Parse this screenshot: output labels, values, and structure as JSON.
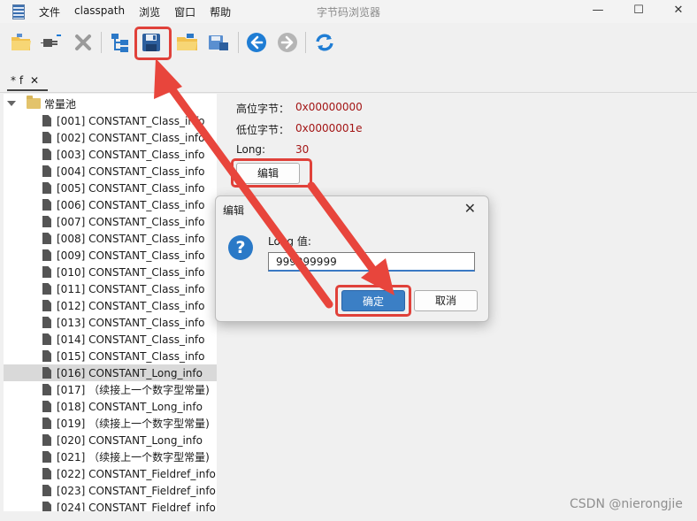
{
  "window": {
    "title": "字节码浏览器",
    "menu": [
      "文件",
      "classpath",
      "浏览",
      "窗口",
      "帮助"
    ],
    "controls": {
      "minimize": "—",
      "maximize": "☐",
      "close": "✕"
    }
  },
  "toolbar": {
    "icons": [
      "open-folder-icon",
      "plug-icon",
      "close-x-icon",
      "tree-icon",
      "save-icon",
      "open-dir-icon",
      "save-as-icon",
      "back-arrow-icon",
      "forward-arrow-icon",
      "refresh-icon"
    ],
    "accent": "#2a79c7"
  },
  "tabs": [
    {
      "label": "* f",
      "close": "✕"
    }
  ],
  "tree": {
    "root": "常量池",
    "items": [
      "[001] CONSTANT_Class_info",
      "[002] CONSTANT_Class_info",
      "[003] CONSTANT_Class_info",
      "[004] CONSTANT_Class_info",
      "[005] CONSTANT_Class_info",
      "[006] CONSTANT_Class_info",
      "[007] CONSTANT_Class_info",
      "[008] CONSTANT_Class_info",
      "[009] CONSTANT_Class_info",
      "[010] CONSTANT_Class_info",
      "[011] CONSTANT_Class_info",
      "[012] CONSTANT_Class_info",
      "[013] CONSTANT_Class_info",
      "[014] CONSTANT_Class_info",
      "[015] CONSTANT_Class_info",
      "[016] CONSTANT_Long_info",
      "[017] （续接上一个数字型常量)",
      "[018] CONSTANT_Long_info",
      "[019] （续接上一个数字型常量)",
      "[020] CONSTANT_Long_info",
      "[021] （续接上一个数字型常量)",
      "[022] CONSTANT_Fieldref_info",
      "[023] CONSTANT_Fieldref_info",
      "[024] CONSTANT_Fieldref_info"
    ],
    "selected_index": 15
  },
  "details": {
    "high_label": "高位字节：",
    "high_value": "0x00000000",
    "low_label": "低位字节：",
    "low_value": "0x0000001e",
    "long_label": "Long:",
    "long_value": "30",
    "edit_button": "编辑"
  },
  "dialog": {
    "title": "编辑",
    "close": "✕",
    "icon": "?",
    "prompt": "Long 值:",
    "input_value": "999999999",
    "ok": "确定",
    "cancel": "取消"
  },
  "watermark": "CSDN @nierongjie",
  "colors": {
    "annotation": "#e0413a",
    "value_text": "#a31515",
    "selection": "#d9d9d9"
  }
}
